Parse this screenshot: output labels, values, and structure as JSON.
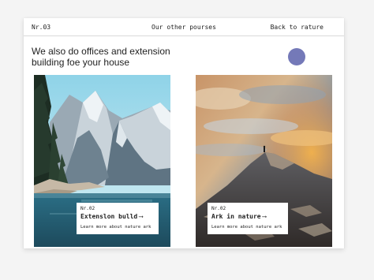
{
  "header": {
    "number": "Nr.03",
    "center_label": "Our other pourses",
    "back_link": "Back to rature"
  },
  "intro": {
    "line1": "We also do offices and extension",
    "line2": "building foe your house"
  },
  "colors": {
    "accent_dot": "#7479b8"
  },
  "cards": [
    {
      "number": "Nr.02",
      "title": "Extenslon bulld",
      "arrow": "⟶",
      "subtitle": "Learn more about nature ark",
      "image": "mountain-lake-photo"
    },
    {
      "number": "Nr.02",
      "title": "Ark in nature",
      "arrow": "⟶",
      "subtitle": "Learn more about nature ark",
      "image": "mountain-sunset-photo"
    }
  ]
}
